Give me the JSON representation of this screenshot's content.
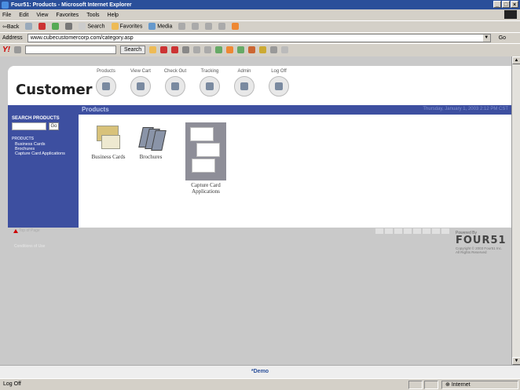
{
  "window": {
    "title": "Four51: Products - Microsoft Internet Explorer",
    "controls": [
      "_",
      "□",
      "×"
    ]
  },
  "menubar": {
    "items": [
      "File",
      "Edit",
      "View",
      "Favorites",
      "Tools",
      "Help"
    ]
  },
  "toolbar": {
    "back_label": "⇦Back",
    "search_label": "Search",
    "favorites_label": "Favorites",
    "media_label": "Media"
  },
  "addressbar": {
    "label": "Address",
    "url": "www.cubecustomercorp.com/category.asp",
    "go_label": "Go"
  },
  "linkbar": {
    "brand": "Y!",
    "search_button": "Search"
  },
  "site": {
    "logo": "Customer",
    "nav": [
      {
        "label": "Products"
      },
      {
        "label": "View Cart"
      },
      {
        "label": "Check Out"
      },
      {
        "label": "Tracking"
      },
      {
        "label": "Admin"
      },
      {
        "label": "Log Off"
      }
    ],
    "section_title": "Products",
    "date": "Thursday, January 1, 2003 2:12 PM CST"
  },
  "sidebar": {
    "search_title": "SEARCH PRODUCTS",
    "search_go": "Go",
    "categories_title": "PRODUCTS",
    "categories": [
      "Business Cards",
      "Brochures",
      "Capture Card Applications"
    ]
  },
  "products": [
    {
      "label": "Business Cards"
    },
    {
      "label": "Brochures"
    },
    {
      "label": "Capture Card Applications"
    }
  ],
  "footer": {
    "top_link": "Top of Page",
    "copyright_left": "Conditions of Use",
    "powered_by": "Powered By",
    "powered_logo": "FOUR51",
    "powered_copy1": "Copyright © 2003 Four51 Inc.",
    "powered_copy2": "All Rights Reserved"
  },
  "demo_bar": {
    "text": "*Demo"
  },
  "statusbar": {
    "status": "Log Off",
    "zone": "Internet"
  },
  "colors": {
    "header_blue": "#3d4fa0",
    "titlebar_blue": "#2a4f9a"
  }
}
